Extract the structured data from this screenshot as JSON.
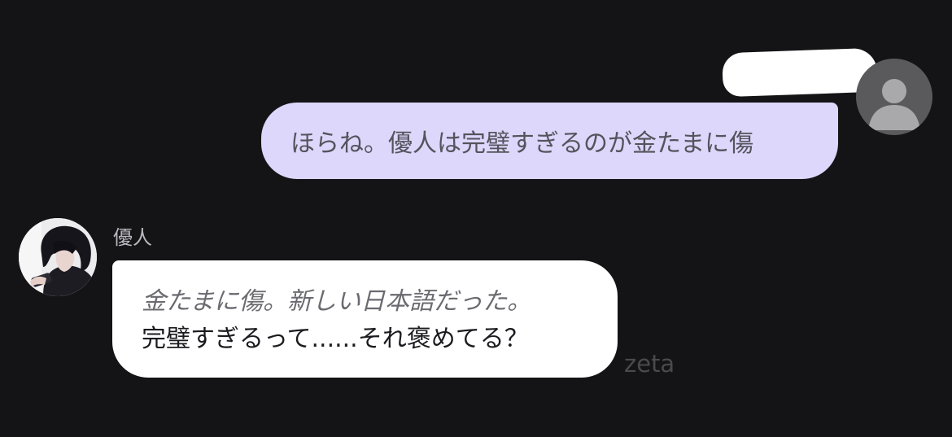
{
  "user_message": {
    "text": "ほらね。優人は完璧すぎるのが金たまに傷",
    "avatar_icon": "default-person-icon"
  },
  "bot_message": {
    "name": "優人",
    "narration": "金たまに傷。新しい日本語だった。",
    "speech": "完璧すぎるって......それ褒めてる？"
  },
  "watermark": "zeta",
  "colors": {
    "background": "#141316",
    "user_bubble": "#dcd7fb",
    "bot_bubble": "#ffffff",
    "user_text": "#55535c",
    "narration_text": "#6b6a70",
    "speech_text": "#1b1b1f"
  }
}
